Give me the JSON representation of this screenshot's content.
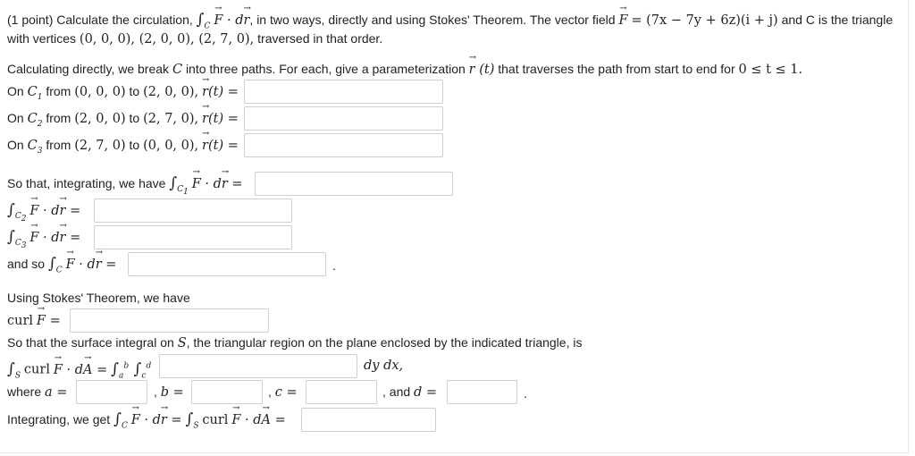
{
  "problem": {
    "intro_prefix": "(1 point) Calculate the circulation,",
    "intro_mid": ", in two ways, directly and using Stokes' Theorem. The vector field",
    "field_expr": "= (7x − 7y + 6z)(i + j)",
    "intro_suffix": "and C is the triangle",
    "vertices_prefix": "with vertices",
    "vertices_math": "(0, 0, 0), (2, 0, 0), (2, 7, 0),",
    "vertices_suffix": "traversed in that order."
  },
  "direct": {
    "intro_a": "Calculating directly, we break",
    "intro_b": "into three paths. For each, give a parameterization",
    "intro_c": "that traverses the path from start to end for",
    "t_range": "0 ≤ t ≤ 1.",
    "c1_from": "from",
    "c1_start": "(0, 0, 0)",
    "c1_to": "to",
    "c1_end": "(2, 0, 0),",
    "c2_start": "(2, 0, 0)",
    "c2_end": "(2, 7, 0),",
    "c3_start": "(2, 7, 0)",
    "c3_end": "(0, 0, 0),",
    "on_label": "On",
    "so_that": "So that, integrating, we have",
    "and_so": "and so",
    "period": "."
  },
  "stokes": {
    "intro": "Using Stokes' Theorem, we have",
    "curl": "curl",
    "surface_a": "So that the surface integral on",
    "surface_b": ", the triangular region on the plane enclosed by the indicated triangle, is",
    "dydx": "dy dx,",
    "where": "where",
    "b_sep": ",",
    "c_sep": ",",
    "and_d": ", and",
    "period": ".",
    "integrating": "Integrating, we get"
  },
  "answers": {
    "r1": "",
    "r2": "",
    "r3": "",
    "int_c1": "",
    "int_c2": "",
    "int_c3": "",
    "int_c": "",
    "curl_f": "",
    "integrand": "",
    "a": "",
    "b": "",
    "c": "",
    "d": "",
    "final": ""
  }
}
